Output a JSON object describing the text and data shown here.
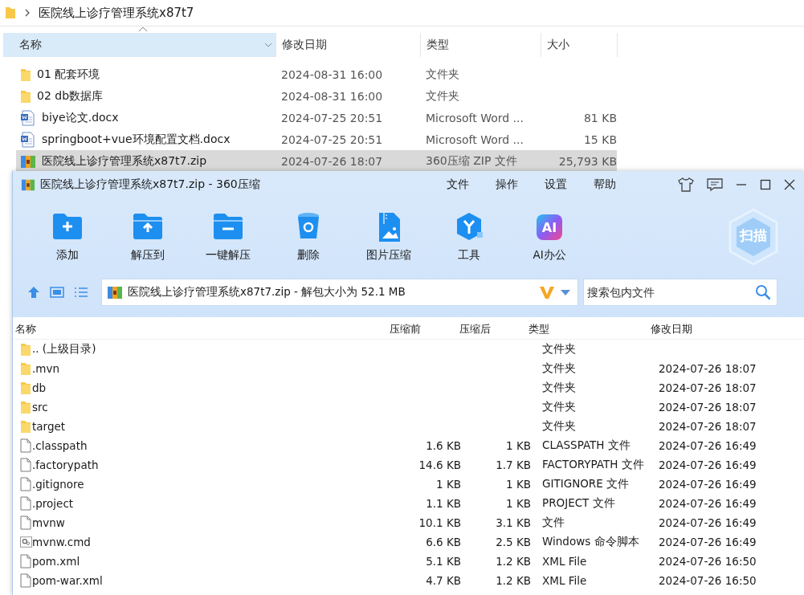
{
  "explorer": {
    "breadcrumb": "医院线上诊疗管理系统x87t7",
    "columns": [
      {
        "label": "名称",
        "sorted": true
      },
      {
        "label": "修改日期",
        "sorted": false
      },
      {
        "label": "类型",
        "sorted": false
      },
      {
        "label": "大小",
        "sorted": false
      }
    ],
    "files": [
      {
        "kind": "folder",
        "name": "01 配套环境",
        "date": "2024-08-31 16:00",
        "type": "文件夹",
        "selected": false
      },
      {
        "kind": "folder",
        "name": "02 db数据库",
        "date": "2024-08-31 16:00",
        "type": "文件夹",
        "selected": false
      },
      {
        "kind": "word",
        "name": "biye论文.docx",
        "date": "2024-07-25 20:51",
        "type": "Microsoft Word ...",
        "size": "81 KB",
        "selected": false
      },
      {
        "kind": "word",
        "name": "springboot+vue环境配置文档.docx",
        "date": "2024-07-25 20:51",
        "type": "Microsoft Word ...",
        "size": "15 KB",
        "selected": false
      },
      {
        "kind": "zip",
        "name": "医院线上诊疗管理系统x87t7.zip",
        "date": "2024-07-26 18:07",
        "type": "360压缩 ZIP 文件",
        "size": "25,793 KB",
        "selected": true
      }
    ]
  },
  "zip_window": {
    "title": "医院线上诊疗管理系统x87t7.zip - 360压缩",
    "menu": [
      "文件",
      "操作",
      "设置",
      "帮助"
    ],
    "tools": [
      {
        "kind": "add",
        "label": "添加"
      },
      {
        "kind": "extract",
        "label": "解压到"
      },
      {
        "kind": "oneclick",
        "label": "一键解压"
      },
      {
        "kind": "delete",
        "label": "删除"
      },
      {
        "kind": "image",
        "label": "图片压缩"
      },
      {
        "kind": "tools",
        "label": "工具"
      },
      {
        "kind": "ai",
        "label": "AI办公",
        "icon_text": "AI"
      }
    ],
    "scan_label": "扫描",
    "address": "医院线上诊疗管理系统x87t7.zip - 解包大小为 52.1 MB",
    "search": {
      "placeholder": "搜索包内文件"
    },
    "columns": [
      "名称",
      "压缩前",
      "压缩后",
      "类型",
      "修改日期"
    ],
    "files": [
      {
        "kind": "folder",
        "name": ".. (上级目录)",
        "type": "文件夹"
      },
      {
        "kind": "folder",
        "name": ".mvn",
        "type": "文件夹",
        "date": "2024-07-26 18:07"
      },
      {
        "kind": "folder",
        "name": "db",
        "type": "文件夹",
        "date": "2024-07-26 18:07"
      },
      {
        "kind": "folder",
        "name": "src",
        "type": "文件夹",
        "date": "2024-07-26 18:07"
      },
      {
        "kind": "folder",
        "name": "target",
        "type": "文件夹",
        "date": "2024-07-26 18:07"
      },
      {
        "kind": "file",
        "name": ".classpath",
        "packed": "1.6 KB",
        "compressed": "1 KB",
        "type": "CLASSPATH 文件",
        "date": "2024-07-26 16:49"
      },
      {
        "kind": "file",
        "name": ".factorypath",
        "packed": "14.6 KB",
        "compressed": "1.7 KB",
        "type": "FACTORYPATH 文件",
        "date": "2024-07-26 16:49"
      },
      {
        "kind": "file",
        "name": ".gitignore",
        "packed": "1 KB",
        "compressed": "1 KB",
        "type": "GITIGNORE 文件",
        "date": "2024-07-26 16:49"
      },
      {
        "kind": "file",
        "name": ".project",
        "packed": "1.1 KB",
        "compressed": "1 KB",
        "type": "PROJECT 文件",
        "date": "2024-07-26 16:49"
      },
      {
        "kind": "file",
        "name": "mvnw",
        "packed": "10.1 KB",
        "compressed": "3.1 KB",
        "type": "文件",
        "date": "2024-07-26 16:49"
      },
      {
        "kind": "script",
        "name": "mvnw.cmd",
        "packed": "6.6 KB",
        "compressed": "2.5 KB",
        "type": "Windows 命令脚本",
        "date": "2024-07-26 16:49"
      },
      {
        "kind": "file",
        "name": "pom.xml",
        "packed": "5.1 KB",
        "compressed": "1.2 KB",
        "type": "XML File",
        "date": "2024-07-26 16:50"
      },
      {
        "kind": "file",
        "name": "pom-war.xml",
        "packed": "4.7 KB",
        "compressed": "1.2 KB",
        "type": "XML File",
        "date": "2024-07-26 16:50"
      }
    ]
  }
}
